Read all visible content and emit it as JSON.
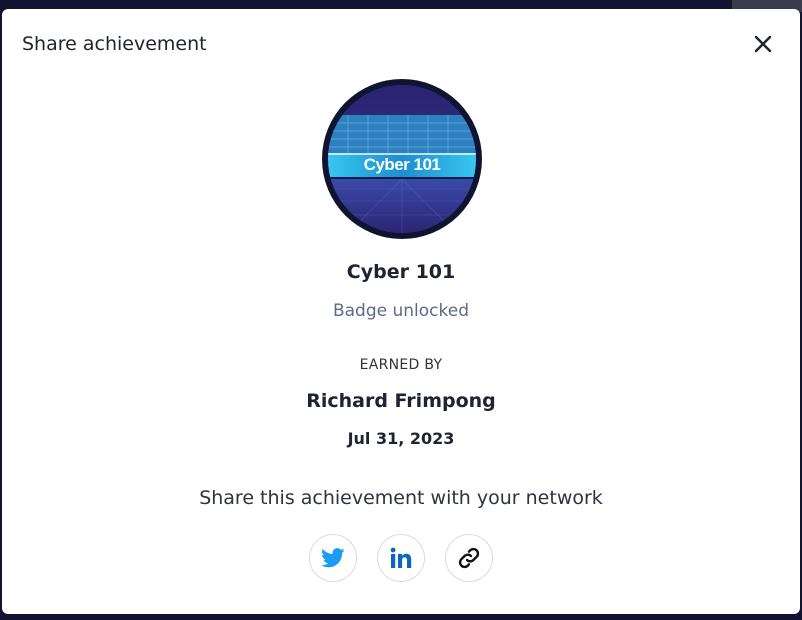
{
  "modal": {
    "title": "Share achievement"
  },
  "badge": {
    "image_text": "Cyber 101",
    "name": "Cyber 101",
    "status": "Badge unlocked"
  },
  "earner": {
    "label": "EARNED BY",
    "name": "Richard Frimpong",
    "date": "Jul 31, 2023"
  },
  "share": {
    "prompt": "Share this achievement with your network",
    "buttons": [
      {
        "icon": "twitter-icon",
        "color": "#1d9bf0"
      },
      {
        "icon": "linkedin-icon",
        "color": "#0a66c2"
      },
      {
        "icon": "link-icon",
        "color": "#111111"
      }
    ]
  },
  "colors": {
    "backdrop": "#121330",
    "badge_ring": "#0f1530",
    "badge_fill": "#3d2f8a",
    "badge_band": "#2bb7e3"
  }
}
